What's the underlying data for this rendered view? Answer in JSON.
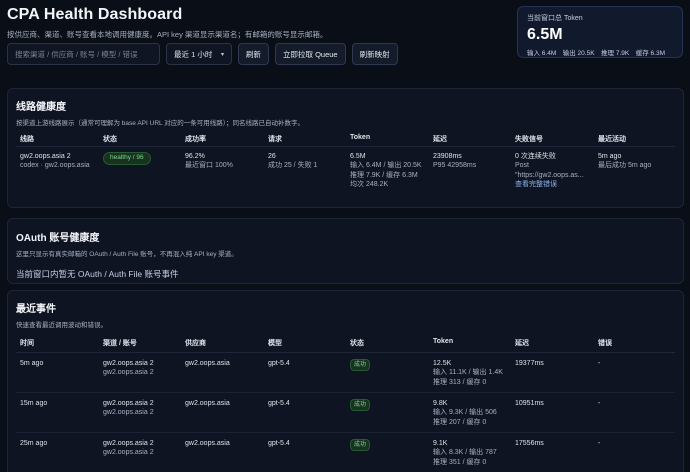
{
  "header": {
    "title": "CPA Health Dashboard",
    "subtitle": "按供应商、渠道、账号查看本地调用健康度。API key 渠道显示渠道名；有邮箱的账号显示邮箱。"
  },
  "token_card": {
    "label": "当前窗口总 Token",
    "value": "6.5M",
    "detail": "输入 6.4M　输出 20.5K　推理 7.9K　缓存 6.3M"
  },
  "toolbar": {
    "search_placeholder": "搜索渠道 / 供应商 / 账号 / 模型 / 错误",
    "search_value": "",
    "range_selected": "最近 1 小时",
    "refresh_label": "刷新",
    "pull_queue_label": "立即拉取 Queue",
    "refresh_mapping_label": "刷新映射"
  },
  "routes": {
    "title": "线路健康度",
    "subtitle": "按渠道上游线路展示（通常可理解为 base API URL 对应的一条可用线路）；同名线路已自动补数字。",
    "columns": [
      "线路",
      "状态",
      "成功率",
      "请求",
      "Token",
      "延迟",
      "失败信号",
      "最近活动"
    ],
    "rows": [
      {
        "route_name": "gw2.oops.asia 2",
        "route_sub": "codex · gw2.oops.asia",
        "status": "healthy / 96",
        "success_rate": "96.2%",
        "success_recent": "最近窗口 100%",
        "requests": "26",
        "requests_detail": "成功 25 / 失败 1",
        "token_total": "6.5M",
        "token_io": "输入 6.4M / 输出 20.5K",
        "token_reason": "推理 7.9K / 缓存 6.3M",
        "token_avg": "均次 248.2K",
        "latency": "23908ms",
        "latency_p95": "P95 42958ms",
        "fail_count": "0 次连续失败",
        "fail_method": "Post",
        "fail_url": "\"https://gw2.oops.as...",
        "fail_link": "查看完整错误",
        "last_active": "5m ago",
        "last_success": "最后成功 5m ago"
      }
    ]
  },
  "oauth": {
    "title": "OAuth 账号健康度",
    "subtitle": "这里只显示有真实邮箱的 OAuth / Auth File 账号，不再混入纯 API key 渠道。",
    "empty": "当前窗口内暂无 OAuth / Auth File 账号事件"
  },
  "events": {
    "title": "最近事件",
    "subtitle": "快速查看最近调用波动和错误。",
    "columns": [
      "时间",
      "渠道 / 账号",
      "供应商",
      "模型",
      "状态",
      "Token",
      "延迟",
      "错误"
    ],
    "rows": [
      {
        "time": "5m ago",
        "channel": "gw2.oops.asia 2",
        "account": "gw2.oops.asia 2",
        "provider": "gw2.oops.asia",
        "model": "gpt-5.4",
        "status": "成功",
        "token_total": "12.5K",
        "token_io": "输入 11.1K / 输出 1.4K",
        "token_reason": "推理 313 / 缓存 0",
        "latency": "19377ms",
        "error": "-"
      },
      {
        "time": "15m ago",
        "channel": "gw2.oops.asia 2",
        "account": "gw2.oops.asia 2",
        "provider": "gw2.oops.asia",
        "model": "gpt-5.4",
        "status": "成功",
        "token_total": "9.8K",
        "token_io": "输入 9.3K / 输出 506",
        "token_reason": "推理 207 / 缓存 0",
        "latency": "10951ms",
        "error": "-"
      },
      {
        "time": "25m ago",
        "channel": "gw2.oops.asia 2",
        "account": "gw2.oops.asia 2",
        "provider": "gw2.oops.asia",
        "model": "gpt-5.4",
        "status": "成功",
        "token_total": "9.1K",
        "token_io": "输入 8.3K / 输出 787",
        "token_reason": "推理 351 / 缓存 0",
        "latency": "17556ms",
        "error": "-"
      }
    ]
  }
}
